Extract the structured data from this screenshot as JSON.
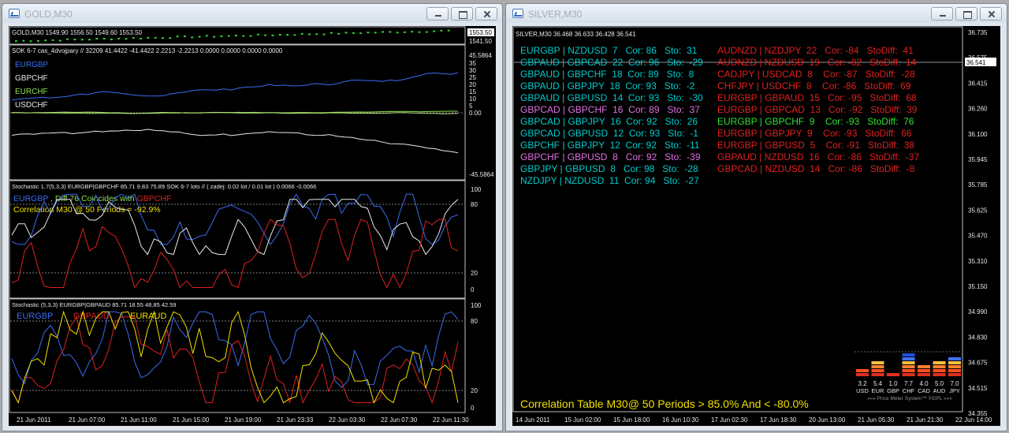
{
  "windows": [
    {
      "title": "GOLD,M30"
    },
    {
      "title": "SILVER,M30"
    }
  ],
  "gold": {
    "header": "GOLD,M30  1549.90 1556.50 1549.60 1553.50",
    "price_labels": [
      "1553.50",
      "1541.50"
    ],
    "sok": {
      "header": "SOK 6-7 cas_4dvojpary  //  32209 41.4422 -41.4422 2.2213 -2.2213 0.0000 0.0000 0.0000 0.0000",
      "legend": [
        "EURGBP",
        "GBPCHF",
        "EURCHF",
        "USDCHF"
      ],
      "scale": [
        "45.5864",
        "35",
        "30",
        "25",
        "20",
        "15",
        "10",
        "5",
        "0.00",
        "-45.5864"
      ]
    },
    "stoch1": {
      "header": "Stochastic 1.7(5,3,3) EURGBP|GBPCHF 85.71 9.83 75.89  SOK 6-7 lots  //  ( zadej: 0.02 lot / 0.01 lot ) 0.0066 -0.0066",
      "line1_a": "EURGBP",
      "line1_b": " , Diff 76 Coincides with ",
      "line1_c": "GBPCHF",
      "line2": "Correlation M30 @ 50 Periods = -92.9%",
      "scale": [
        "100",
        "80",
        "20",
        "0"
      ]
    },
    "stoch2": {
      "header": "Stochastic (5,3,3) EURGBP|GBPAUD 85.71 18.55 48.85 42.59",
      "legend": [
        "EURGBP",
        "GBPAUD",
        "EURAUD"
      ],
      "scale": [
        "100",
        "80",
        "20",
        "0"
      ]
    },
    "time_axis": [
      "21 Jun 2011",
      "21 Jun 07:00",
      "21 Jun 11:00",
      "21 Jun 15:00",
      "21 Jun 19:00",
      "21 Jun 23:33",
      "22 Jun 03:30",
      "22 Jun 07:30",
      "22 Jun 11:30"
    ]
  },
  "silver": {
    "header": "SILVER,M30  36.468 36.633 36.428 36.541",
    "price_scale": [
      "36.735",
      "36.575",
      "36.415",
      "36.260",
      "36.100",
      "35.945",
      "35.785",
      "35.625",
      "35.470",
      "35.310",
      "35.150",
      "34.990",
      "34.830",
      "34.675",
      "34.515",
      "34.355"
    ],
    "current_price": "36.541",
    "positive_table": [
      {
        "text": "EURGBP | NZDUSD  7   Cor: 86   Sto:  31",
        "color": "#00cccc"
      },
      {
        "text": "GBPAUD | GBPCAD  22  Cor: 96   Sto:  -29",
        "color": "#00cccc"
      },
      {
        "text": "GBPAUD | GBPCHF  18  Cor: 89   Sto:  8",
        "color": "#00cccc"
      },
      {
        "text": "GBPAUD | GBPJPY  18  Cor: 93   Sto:  -2",
        "color": "#00cccc"
      },
      {
        "text": "GBPAUD | GBPUSD  14  Cor: 93   Sto:  -30",
        "color": "#00cccc"
      },
      {
        "text": "GBPCAD | GBPCHF  16  Cor: 89   Sto:  37",
        "color": "#e070e0"
      },
      {
        "text": "GBPCAD | GBPJPY  16  Cor: 92   Sto:  26",
        "color": "#00cccc"
      },
      {
        "text": "GBPCAD | GBPUSD  12  Cor: 93   Sto:  -1",
        "color": "#00cccc"
      },
      {
        "text": "GBPCHF | GBPJPY  12  Cor: 92   Sto:  -11",
        "color": "#00cccc"
      },
      {
        "text": "GBPCHF | GBPUSD  8   Cor: 92   Sto:  -39",
        "color": "#e070e0"
      },
      {
        "text": "GBPJPY | GBPUSD  8   Cor: 98   Sto:  -28",
        "color": "#00cccc"
      },
      {
        "text": "NZDJPY | NZDUSD  11  Cor: 94   Sto:  -27",
        "color": "#00cccc"
      }
    ],
    "negative_table": [
      {
        "text": "AUDNZD | NZDJPY  22   Cor: -84   StoDiff:  41",
        "color": "#e02020"
      },
      {
        "text": "AUDNZD | NZDUSD  19   Cor: -82   StoDiff:  14",
        "color": "#e02020"
      },
      {
        "text": "CADJPY | USDCAD  8    Cor: -87   StoDiff:  -28",
        "color": "#e02020"
      },
      {
        "text": "CHFJPY | USDCHF  8    Cor: -86   StoDiff:  69",
        "color": "#e02020"
      },
      {
        "text": "EURGBP | GBPAUD  15   Cor: -95   StoDiff:  68",
        "color": "#e02020"
      },
      {
        "text": "EURGBP | GBPCAD  13   Cor: -92   StoDiff:  39",
        "color": "#e02020"
      },
      {
        "text": "EURGBP | GBPCHF  9    Cor: -93   StoDiff:  76",
        "color": "#30e030"
      },
      {
        "text": "EURGBP | GBPJPY  9    Cor: -93   StoDiff:  66",
        "color": "#e02020"
      },
      {
        "text": "EURGBP | GBPUSD  5    Cor: -91   StoDiff:  38",
        "color": "#e02020"
      },
      {
        "text": "GBPAUD | NZDUSD  16   Cor: -86   StoDiff:  -37",
        "color": "#e02020"
      },
      {
        "text": "GBPCAD | NZDUSD  14   Cor: -86   StoDiff:  -8",
        "color": "#e02020"
      }
    ],
    "footer": "Correlation Table M30@ 50 Periods > 85.0% And < -80.0%",
    "time_axis": [
      "14 Jun 2011",
      "15 Jun 02:00",
      "15 Jun 18:00",
      "16 Jun 10:30",
      "17 Jun 02:30",
      "17 Jun 18:30",
      "20 Jun 13:00",
      "21 Jun 05:30",
      "21 Jun 21:30",
      "22 Jun 14:00"
    ],
    "meter": {
      "currencies": [
        {
          "code": "USD",
          "value": "3.2",
          "level": 3.2
        },
        {
          "code": "EUR",
          "value": "5.4",
          "level": 5.4
        },
        {
          "code": "GBP",
          "value": "1.0",
          "level": 1.0
        },
        {
          "code": "CHF",
          "value": "7.7",
          "level": 7.7
        },
        {
          "code": "CAD",
          "value": "4.0",
          "level": 4.0
        },
        {
          "code": "AUD",
          "value": "5.0",
          "level": 5.0
        },
        {
          "code": "JPY",
          "value": "7.0",
          "level": 7.0
        }
      ],
      "caption": "»»» Price Meter System™ ©GPL «««"
    }
  },
  "colors": {
    "blue": "#3a6cf0",
    "white": "#e8e8e8",
    "green": "#90e050",
    "red": "#e02020",
    "yellow": "#f0e000",
    "cyan": "#00cccc",
    "magenta": "#e070e0"
  }
}
